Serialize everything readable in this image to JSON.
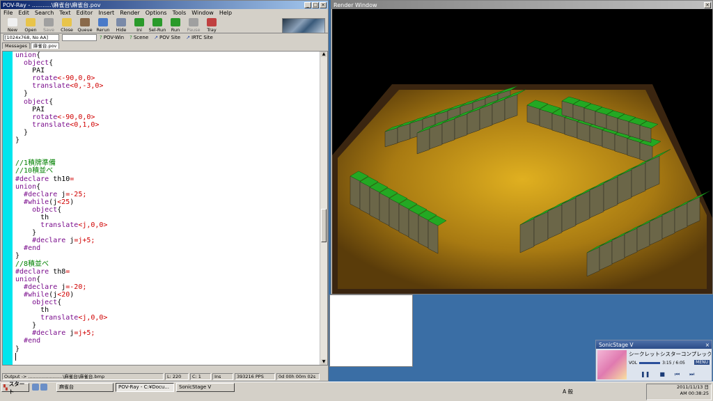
{
  "pov": {
    "title": "POV-Ray - ...........\\麻雀台\\麻雀台.pov",
    "menu": [
      "File",
      "Edit",
      "Search",
      "Text",
      "Editor",
      "Insert",
      "Render",
      "Options",
      "Tools",
      "Window",
      "Help"
    ],
    "toolbar": [
      {
        "label": "New",
        "icon": "new-file-icon",
        "color": "#f0f0f0",
        "disabled": false
      },
      {
        "label": "Open",
        "icon": "open-folder-icon",
        "color": "#e8c44a",
        "disabled": false
      },
      {
        "label": "Save",
        "icon": "save-icon",
        "color": "#a0a0a0",
        "disabled": true
      },
      {
        "label": "Close",
        "icon": "close-file-icon",
        "color": "#e8c44a",
        "disabled": false
      },
      {
        "label": "Queue",
        "icon": "queue-icon",
        "color": "#8a6a4a",
        "disabled": false
      },
      {
        "label": "Rerun",
        "icon": "rerun-icon",
        "color": "#4a7ac8",
        "disabled": false
      },
      {
        "label": "Hide",
        "icon": "hide-icon",
        "color": "#7a8aa8",
        "disabled": false
      },
      {
        "label": "Ini",
        "icon": "ini-icon",
        "color": "#2a9a2a",
        "disabled": false
      },
      {
        "label": "Sel-Run",
        "icon": "sel-run-icon",
        "color": "#2a9a2a",
        "disabled": false
      },
      {
        "label": "Run",
        "icon": "run-icon",
        "color": "#2a9a2a",
        "disabled": false
      },
      {
        "label": "Pause",
        "icon": "pause-icon",
        "color": "#a0a0a0",
        "disabled": true
      },
      {
        "label": "Tray",
        "icon": "tray-icon",
        "color": "#c04040",
        "disabled": false
      }
    ],
    "resolution": "[1024x768, No AA]",
    "links": [
      {
        "label": "POV-Win",
        "icon": "help-icon"
      },
      {
        "label": "Scene",
        "icon": "help-icon"
      },
      {
        "label": "POV Site",
        "icon": "web-icon"
      },
      {
        "label": "IRTC Site",
        "icon": "web-icon"
      }
    ],
    "tabs": [
      "Messages",
      "麻雀台.pov"
    ],
    "code_lines": [
      [
        {
          "c": "kw",
          "t": "union"
        },
        {
          "c": "id",
          "t": "{"
        }
      ],
      [
        {
          "c": "id",
          "t": "  "
        },
        {
          "c": "kw",
          "t": "object"
        },
        {
          "c": "id",
          "t": "{"
        }
      ],
      [
        {
          "c": "id",
          "t": "    PAI"
        }
      ],
      [
        {
          "c": "id",
          "t": "    "
        },
        {
          "c": "kw",
          "t": "rotate"
        },
        {
          "c": "nm",
          "t": "<-90,0,0>"
        }
      ],
      [
        {
          "c": "id",
          "t": "    "
        },
        {
          "c": "kw",
          "t": "translate"
        },
        {
          "c": "nm",
          "t": "<0,-3,0>"
        }
      ],
      [
        {
          "c": "id",
          "t": "  }"
        }
      ],
      [
        {
          "c": "id",
          "t": "  "
        },
        {
          "c": "kw",
          "t": "object"
        },
        {
          "c": "id",
          "t": "{"
        }
      ],
      [
        {
          "c": "id",
          "t": "    PAI"
        }
      ],
      [
        {
          "c": "id",
          "t": "    "
        },
        {
          "c": "kw",
          "t": "rotate"
        },
        {
          "c": "nm",
          "t": "<-90,0,0>"
        }
      ],
      [
        {
          "c": "id",
          "t": "    "
        },
        {
          "c": "kw",
          "t": "translate"
        },
        {
          "c": "nm",
          "t": "<0,1,0>"
        }
      ],
      [
        {
          "c": "id",
          "t": "  }"
        }
      ],
      [
        {
          "c": "id",
          "t": "}"
        }
      ],
      [
        {
          "c": "id",
          "t": ""
        }
      ],
      [
        {
          "c": "id",
          "t": ""
        }
      ],
      [
        {
          "c": "cm",
          "t": "//1積牌準備"
        }
      ],
      [
        {
          "c": "cm",
          "t": "//10積並べ"
        }
      ],
      [
        {
          "c": "kw",
          "t": "#declare"
        },
        {
          "c": "id",
          "t": " th10"
        },
        {
          "c": "nm",
          "t": "="
        }
      ],
      [
        {
          "c": "kw",
          "t": "union"
        },
        {
          "c": "id",
          "t": "{"
        }
      ],
      [
        {
          "c": "id",
          "t": "  "
        },
        {
          "c": "kw",
          "t": "#declare"
        },
        {
          "c": "id",
          "t": " j"
        },
        {
          "c": "nm",
          "t": "=-25;"
        }
      ],
      [
        {
          "c": "id",
          "t": "  "
        },
        {
          "c": "kw",
          "t": "#while"
        },
        {
          "c": "id",
          "t": "(j"
        },
        {
          "c": "nm",
          "t": "<25"
        },
        {
          "c": "id",
          "t": ")"
        }
      ],
      [
        {
          "c": "id",
          "t": "    "
        },
        {
          "c": "kw",
          "t": "object"
        },
        {
          "c": "id",
          "t": "{"
        }
      ],
      [
        {
          "c": "id",
          "t": "      th"
        }
      ],
      [
        {
          "c": "id",
          "t": "      "
        },
        {
          "c": "kw",
          "t": "translate"
        },
        {
          "c": "nm",
          "t": "<j,0,0>"
        }
      ],
      [
        {
          "c": "id",
          "t": "    }"
        }
      ],
      [
        {
          "c": "id",
          "t": "    "
        },
        {
          "c": "kw",
          "t": "#declare"
        },
        {
          "c": "id",
          "t": " j"
        },
        {
          "c": "nm",
          "t": "=j+5;"
        }
      ],
      [
        {
          "c": "id",
          "t": "  "
        },
        {
          "c": "kw",
          "t": "#end"
        }
      ],
      [
        {
          "c": "id",
          "t": "}"
        }
      ],
      [
        {
          "c": "cm",
          "t": "//8積並べ"
        }
      ],
      [
        {
          "c": "kw",
          "t": "#declare"
        },
        {
          "c": "id",
          "t": " th8"
        },
        {
          "c": "nm",
          "t": "="
        }
      ],
      [
        {
          "c": "kw",
          "t": "union"
        },
        {
          "c": "id",
          "t": "{"
        }
      ],
      [
        {
          "c": "id",
          "t": "  "
        },
        {
          "c": "kw",
          "t": "#declare"
        },
        {
          "c": "id",
          "t": " j"
        },
        {
          "c": "nm",
          "t": "=-20;"
        }
      ],
      [
        {
          "c": "id",
          "t": "  "
        },
        {
          "c": "kw",
          "t": "#while"
        },
        {
          "c": "id",
          "t": "(j"
        },
        {
          "c": "nm",
          "t": "<20"
        },
        {
          "c": "id",
          "t": ")"
        }
      ],
      [
        {
          "c": "id",
          "t": "    "
        },
        {
          "c": "kw",
          "t": "object"
        },
        {
          "c": "id",
          "t": "{"
        }
      ],
      [
        {
          "c": "id",
          "t": "      th"
        }
      ],
      [
        {
          "c": "id",
          "t": "      "
        },
        {
          "c": "kw",
          "t": "translate"
        },
        {
          "c": "nm",
          "t": "<j,0,0>"
        }
      ],
      [
        {
          "c": "id",
          "t": "    }"
        }
      ],
      [
        {
          "c": "id",
          "t": "    "
        },
        {
          "c": "kw",
          "t": "#declare"
        },
        {
          "c": "id",
          "t": " j"
        },
        {
          "c": "nm",
          "t": "=j+5;"
        }
      ],
      [
        {
          "c": "id",
          "t": "  "
        },
        {
          "c": "kw",
          "t": "#end"
        }
      ],
      [
        {
          "c": "id",
          "t": "}"
        }
      ],
      [
        {
          "c": "id",
          "t": ""
        }
      ]
    ],
    "status": {
      "output": "Output -> ........................\\麻雀台\\麻雀台.bmp",
      "line": "L: 220",
      "col": "C: 1",
      "mode": "Ins",
      "pps": "393216 PPS",
      "time": "0d 00h 00m 02s"
    }
  },
  "render": {
    "title": "Render Window",
    "colors": {
      "background": "#000000",
      "table": "#b08a1a",
      "rim": "#5a3a18",
      "tile_green": "#1e9a1e",
      "tile_body": "#6b6b4a"
    }
  },
  "sonic": {
    "title": "SonicStage V",
    "song": "シークレットシスターコンプレック...",
    "vol_label": "VOL",
    "volume": 0.65,
    "track": "3:15 / 6:05",
    "menu": "MENU"
  },
  "taskbar": {
    "start": "スタート",
    "tasks": [
      "麻雀台",
      "POV-Ray - C:¥Docu...",
      "SonicStage V"
    ],
    "ime": "A 般",
    "date": "2011/11/13 日",
    "time": "AM 00:38:25"
  }
}
